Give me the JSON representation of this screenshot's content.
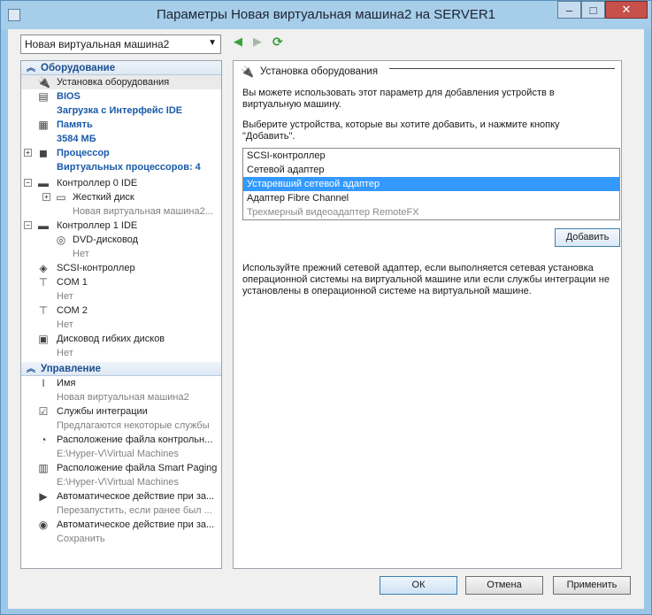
{
  "window": {
    "title": "Параметры Новая виртуальная машина2 на SERVER1"
  },
  "toolbar": {
    "vm_selected": "Новая виртуальная машина2"
  },
  "sidebar": {
    "hardware_header": "Оборудование",
    "management_header": "Управление",
    "hardware": [
      {
        "name": "Установка оборудования",
        "sub": ""
      },
      {
        "name": "BIOS",
        "sub": "Загрузка с Интерфейс IDE"
      },
      {
        "name": "Память",
        "sub": "3584 МБ"
      },
      {
        "name": "Процессор",
        "sub": "Виртуальных процессоров: 4"
      },
      {
        "name": "Контроллер 0 IDE",
        "sub": ""
      },
      {
        "name": "Жесткий диск",
        "sub": "Новая виртуальная машина2..."
      },
      {
        "name": "Контроллер 1 IDE",
        "sub": ""
      },
      {
        "name": "DVD-дисковод",
        "sub": "Нет"
      },
      {
        "name": "SCSI-контроллер",
        "sub": ""
      },
      {
        "name": "COM 1",
        "sub": "Нет"
      },
      {
        "name": "COM 2",
        "sub": "Нет"
      },
      {
        "name": "Дисковод гибких дисков",
        "sub": "Нет"
      }
    ],
    "management": [
      {
        "name": "Имя",
        "sub": "Новая виртуальная машина2"
      },
      {
        "name": "Службы интеграции",
        "sub": "Предлагаются некоторые службы"
      },
      {
        "name": "Расположение файла контрольн...",
        "sub": "E:\\Hyper-V\\Virtual Machines"
      },
      {
        "name": "Расположение файла Smart Paging",
        "sub": "E:\\Hyper-V\\Virtual Machines"
      },
      {
        "name": "Автоматическое действие при за...",
        "sub": "Перезапустить, если ранее был ..."
      },
      {
        "name": "Автоматическое действие при за...",
        "sub": "Сохранить"
      }
    ]
  },
  "main": {
    "section_title": "Установка оборудования",
    "p1": "Вы можете использовать этот параметр для добавления устройств в виртуальную машину.",
    "p2": "Выберите устройства, которые вы хотите добавить, и нажмите кнопку \"Добавить\".",
    "devices": [
      "SCSI-контроллер",
      "Сетевой адаптер",
      "Устаревший сетевой адаптер",
      "Адаптер Fibre Channel",
      "Трехмерный видеоадаптер RemoteFX"
    ],
    "add_label": "Добавить",
    "p3": "Используйте прежний сетевой адаптер, если выполняется сетевая установка операционной системы на виртуальной машине или если службы интеграции не установлены в операционной системе на виртуальной машине."
  },
  "buttons": {
    "ok": "ОК",
    "cancel": "Отмена",
    "apply": "Применить"
  }
}
